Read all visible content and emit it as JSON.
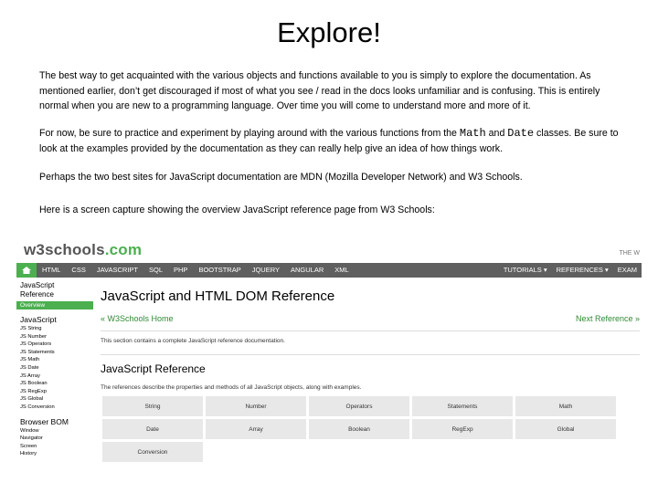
{
  "title": "Explore!",
  "paragraphs": {
    "p1": "The best way to get acquainted with the various objects and functions available to you is simply to explore the documentation. As mentioned earlier, don’t get discouraged if most of what you see / read in the docs looks unfamiliar and is confusing. This is entirely normal when you are new to a programming language. Over time you will come to understand more and more of it.",
    "p2_a": "For now, be sure to practice and experiment by playing around with the various functions from the ",
    "p2_math": "Math",
    "p2_and": " and ",
    "p2_date": "Date",
    "p2_b": " classes. Be sure to look at the examples provided by the documentation as they can really help give an idea of how things work.",
    "p3": "Perhaps the two best sites for JavaScript documentation are MDN (Mozilla Developer Network) and W3 Schools.",
    "p4": "Here is a screen capture showing the overview JavaScript reference page from W3 Schools:"
  },
  "screenshot": {
    "logo_w3": "w3schools",
    "logo_com": ".com",
    "top_right": "THE W",
    "nav": [
      "HTML",
      "CSS",
      "JAVASCRIPT",
      "SQL",
      "PHP",
      "BOOTSTRAP",
      "JQUERY",
      "ANGULAR",
      "XML"
    ],
    "nav_right": [
      "TUTORIALS ▾",
      "REFERENCES ▾",
      "EXAM"
    ],
    "sidebar": {
      "heading": "JavaScript Reference",
      "active": "Overview",
      "section1": "JavaScript",
      "items1": [
        "JS String",
        "JS Number",
        "JS Operators",
        "JS Statements",
        "JS Math",
        "JS Date",
        "JS Array",
        "JS Boolean",
        "JS RegExp",
        "JS Global",
        "JS Conversion"
      ],
      "section2": "Browser BOM",
      "items2": [
        "Window",
        "Navigator",
        "Screen",
        "History"
      ]
    },
    "main": {
      "heading": "JavaScript and HTML DOM Reference",
      "prev": "« W3Schools Home",
      "next": "Next Reference »",
      "section_text": "This section contains a complete JavaScript reference documentation.",
      "subheading": "JavaScript Reference",
      "desc": "The references describe the properties and methods of all JavaScript objects, along with examples.",
      "grid": [
        "String",
        "Number",
        "Operators",
        "Statements",
        "Math",
        "Date",
        "Array",
        "Boolean",
        "RegExp",
        "Global",
        "Conversion"
      ]
    }
  }
}
